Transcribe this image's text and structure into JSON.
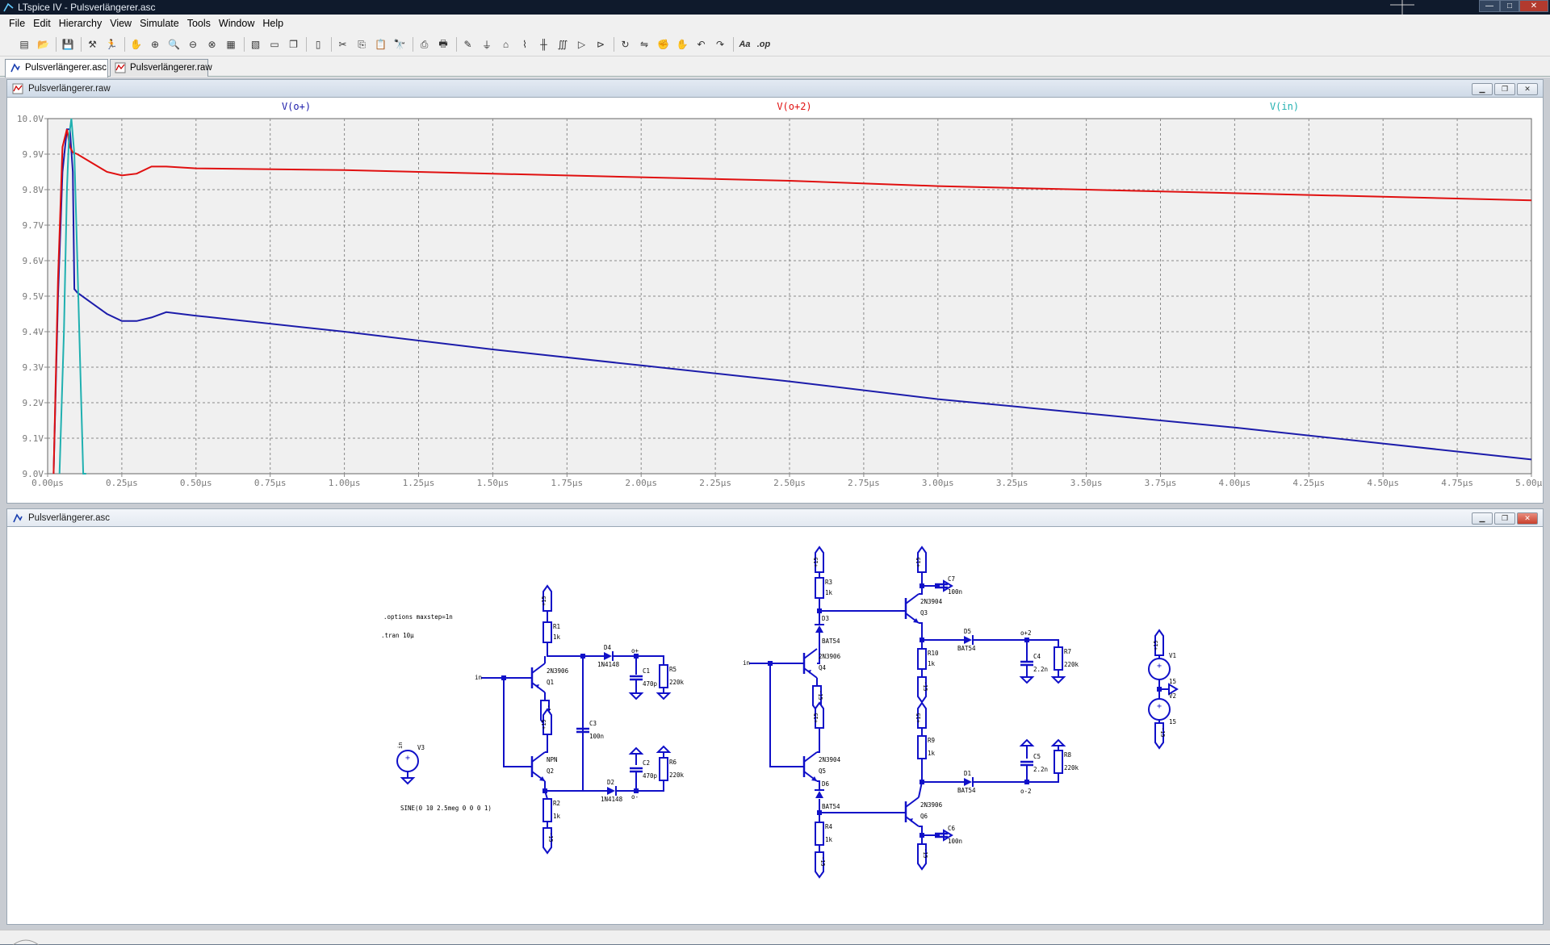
{
  "window": {
    "title": "LTspice IV - Pulsverlängerer.asc",
    "minimize": "—",
    "maximize": "□",
    "close": "✕"
  },
  "menu": [
    "File",
    "Edit",
    "Hierarchy",
    "View",
    "Simulate",
    "Tools",
    "Window",
    "Help"
  ],
  "toolbar_icons": [
    "new-schematic-icon",
    "open-icon",
    "save-icon",
    "control-panel-icon",
    "run-icon",
    "halt-icon",
    "zoom-in-icon",
    "zoom-pan-icon",
    "zoom-out-icon",
    "zoom-fit-icon",
    "autorange-icon",
    "manual-limits-icon",
    "tile-horizontal-icon",
    "cascade-icon",
    "tile-vertical-icon",
    "cut-icon",
    "copy-icon",
    "paste-icon",
    "find-icon",
    "print-setup-icon",
    "print-icon",
    "wire-icon",
    "ground-icon",
    "label-net-icon",
    "resistor-icon",
    "capacitor-icon",
    "inductor-icon",
    "diode-icon",
    "component-icon",
    "rotate-icon",
    "mirror-icon",
    "drag-icon",
    "move-icon",
    "undo-icon",
    "redo-icon",
    "text-icon",
    "spice-directive-icon"
  ],
  "tabs": [
    {
      "label": "Pulsverlängerer.asc",
      "icon": "schematic-icon",
      "active": true
    },
    {
      "label": "Pulsverlängerer.raw",
      "icon": "waveform-icon",
      "active": false
    }
  ],
  "plot_window": {
    "title": "Pulsverlängerer.raw",
    "buttons": {
      "minimize": "▁",
      "restore": "❐",
      "close": "✕"
    }
  },
  "schematic_window": {
    "title": "Pulsverlängerer.asc",
    "buttons": {
      "minimize": "▁",
      "restore": "❐",
      "close": "✕"
    }
  },
  "chart_data": {
    "type": "line",
    "title": "",
    "xlabel": "",
    "ylabel": "",
    "xlim": [
      0,
      5.0
    ],
    "ylim": [
      9.0,
      10.0
    ],
    "grid": true,
    "legend": "top",
    "background": "#f0f0f0",
    "x_ticks": [
      "0.00µs",
      "0.25µs",
      "0.50µs",
      "0.75µs",
      "1.00µs",
      "1.25µs",
      "1.50µs",
      "1.75µs",
      "2.00µs",
      "2.25µs",
      "2.50µs",
      "2.75µs",
      "3.00µs",
      "3.25µs",
      "3.50µs",
      "3.75µs",
      "4.00µs",
      "4.25µs",
      "4.50µs",
      "4.75µs",
      "5.00µs"
    ],
    "y_ticks": [
      "9.0V",
      "9.1V",
      "9.2V",
      "9.3V",
      "9.4V",
      "9.5V",
      "9.6V",
      "9.7V",
      "9.8V",
      "9.9V",
      "10.0V"
    ],
    "series": [
      {
        "name": "V(o+)",
        "color": "#1c1caa",
        "x": [
          0.02,
          0.035,
          0.05,
          0.065,
          0.075,
          0.085,
          0.09,
          0.1,
          0.15,
          0.2,
          0.25,
          0.3,
          0.35,
          0.4,
          0.5,
          1.0,
          1.5,
          2.0,
          2.5,
          3.0,
          3.5,
          4.0,
          4.5,
          5.0
        ],
        "y": [
          9.0,
          9.5,
          9.85,
          9.97,
          9.97,
          9.85,
          9.52,
          9.51,
          9.48,
          9.45,
          9.43,
          9.43,
          9.44,
          9.455,
          9.445,
          9.4,
          9.35,
          9.305,
          9.26,
          9.21,
          9.17,
          9.13,
          9.085,
          9.04
        ]
      },
      {
        "name": "V(o+2)",
        "color": "#e01010",
        "x": [
          0.02,
          0.035,
          0.05,
          0.065,
          0.075,
          0.085,
          0.1,
          0.15,
          0.2,
          0.25,
          0.3,
          0.35,
          0.4,
          0.5,
          1.0,
          1.5,
          2.0,
          2.5,
          3.0,
          3.5,
          4.0,
          4.5,
          5.0
        ],
        "y": [
          9.0,
          9.55,
          9.92,
          9.97,
          9.92,
          9.905,
          9.9,
          9.875,
          9.85,
          9.84,
          9.845,
          9.865,
          9.865,
          9.86,
          9.855,
          9.845,
          9.835,
          9.825,
          9.81,
          9.8,
          9.79,
          9.78,
          9.77
        ]
      },
      {
        "name": "V(in)",
        "color": "#20b0b0",
        "x": [
          0.04,
          0.055,
          0.065,
          0.072,
          0.08,
          0.09,
          0.1,
          0.11,
          0.12,
          0.13
        ],
        "y": [
          9.0,
          9.4,
          9.8,
          9.95,
          10.0,
          9.9,
          9.6,
          9.3,
          9.0,
          8.95
        ]
      }
    ]
  },
  "schematic": {
    "directives": [
      ".options maxstep=1n",
      ".tran 10µ"
    ],
    "source_text": "SINE(0 10 2.5meg 0 0 0 1)",
    "labels": {
      "in1": "in",
      "in2": "in",
      "R1": "R1",
      "R1v": "1k",
      "R2": "R2",
      "R2v": "1k",
      "Q1": "Q1",
      "Q1m": "2N3906",
      "Q2": "Q2",
      "Q2m": "NPN",
      "D4": "D4",
      "D4m": "1N4148",
      "D2": "D2",
      "D2m": "1N4148",
      "C1": "C1",
      "C1v": "470p",
      "C2": "C2",
      "C2v": "470p",
      "C3": "C3",
      "C3v": "100n",
      "R5": "R5",
      "R5v": "220k",
      "R6": "R6",
      "R6v": "220k",
      "o1": "o+",
      "o2": "o-",
      "R3": "R3",
      "R3v": "1k",
      "R4": "R4",
      "R4v": "1k",
      "D3": "D3",
      "D3m": "BAT54",
      "D6": "D6",
      "D6m": "BAT54",
      "Q4": "Q4",
      "Q4m": "2N3906",
      "Q5": "Q5",
      "Q5m": "2N3904",
      "Q3": "Q3",
      "Q3m": "2N3904",
      "Q6": "Q6",
      "Q6m": "2N3906",
      "C7": "C7",
      "C7v": "100n",
      "C6": "C6",
      "C6v": "100n",
      "R10": "R10",
      "R10v": "1k",
      "R9": "R9",
      "R9v": "1k",
      "D5": "D5",
      "D5m": "BAT54",
      "D1": "D1",
      "D1m": "BAT54",
      "C4": "C4",
      "C4v": "2.2n",
      "C5": "C5",
      "C5v": "2.2n",
      "R7": "R7",
      "R7v": "220k",
      "R8": "R8",
      "R8v": "220k",
      "o3": "o+2",
      "o4": "o-2",
      "V1": "V1",
      "V1v": "15",
      "V2": "V2",
      "V2v": "15",
      "V3": "V3",
      "V3n": "in"
    }
  }
}
